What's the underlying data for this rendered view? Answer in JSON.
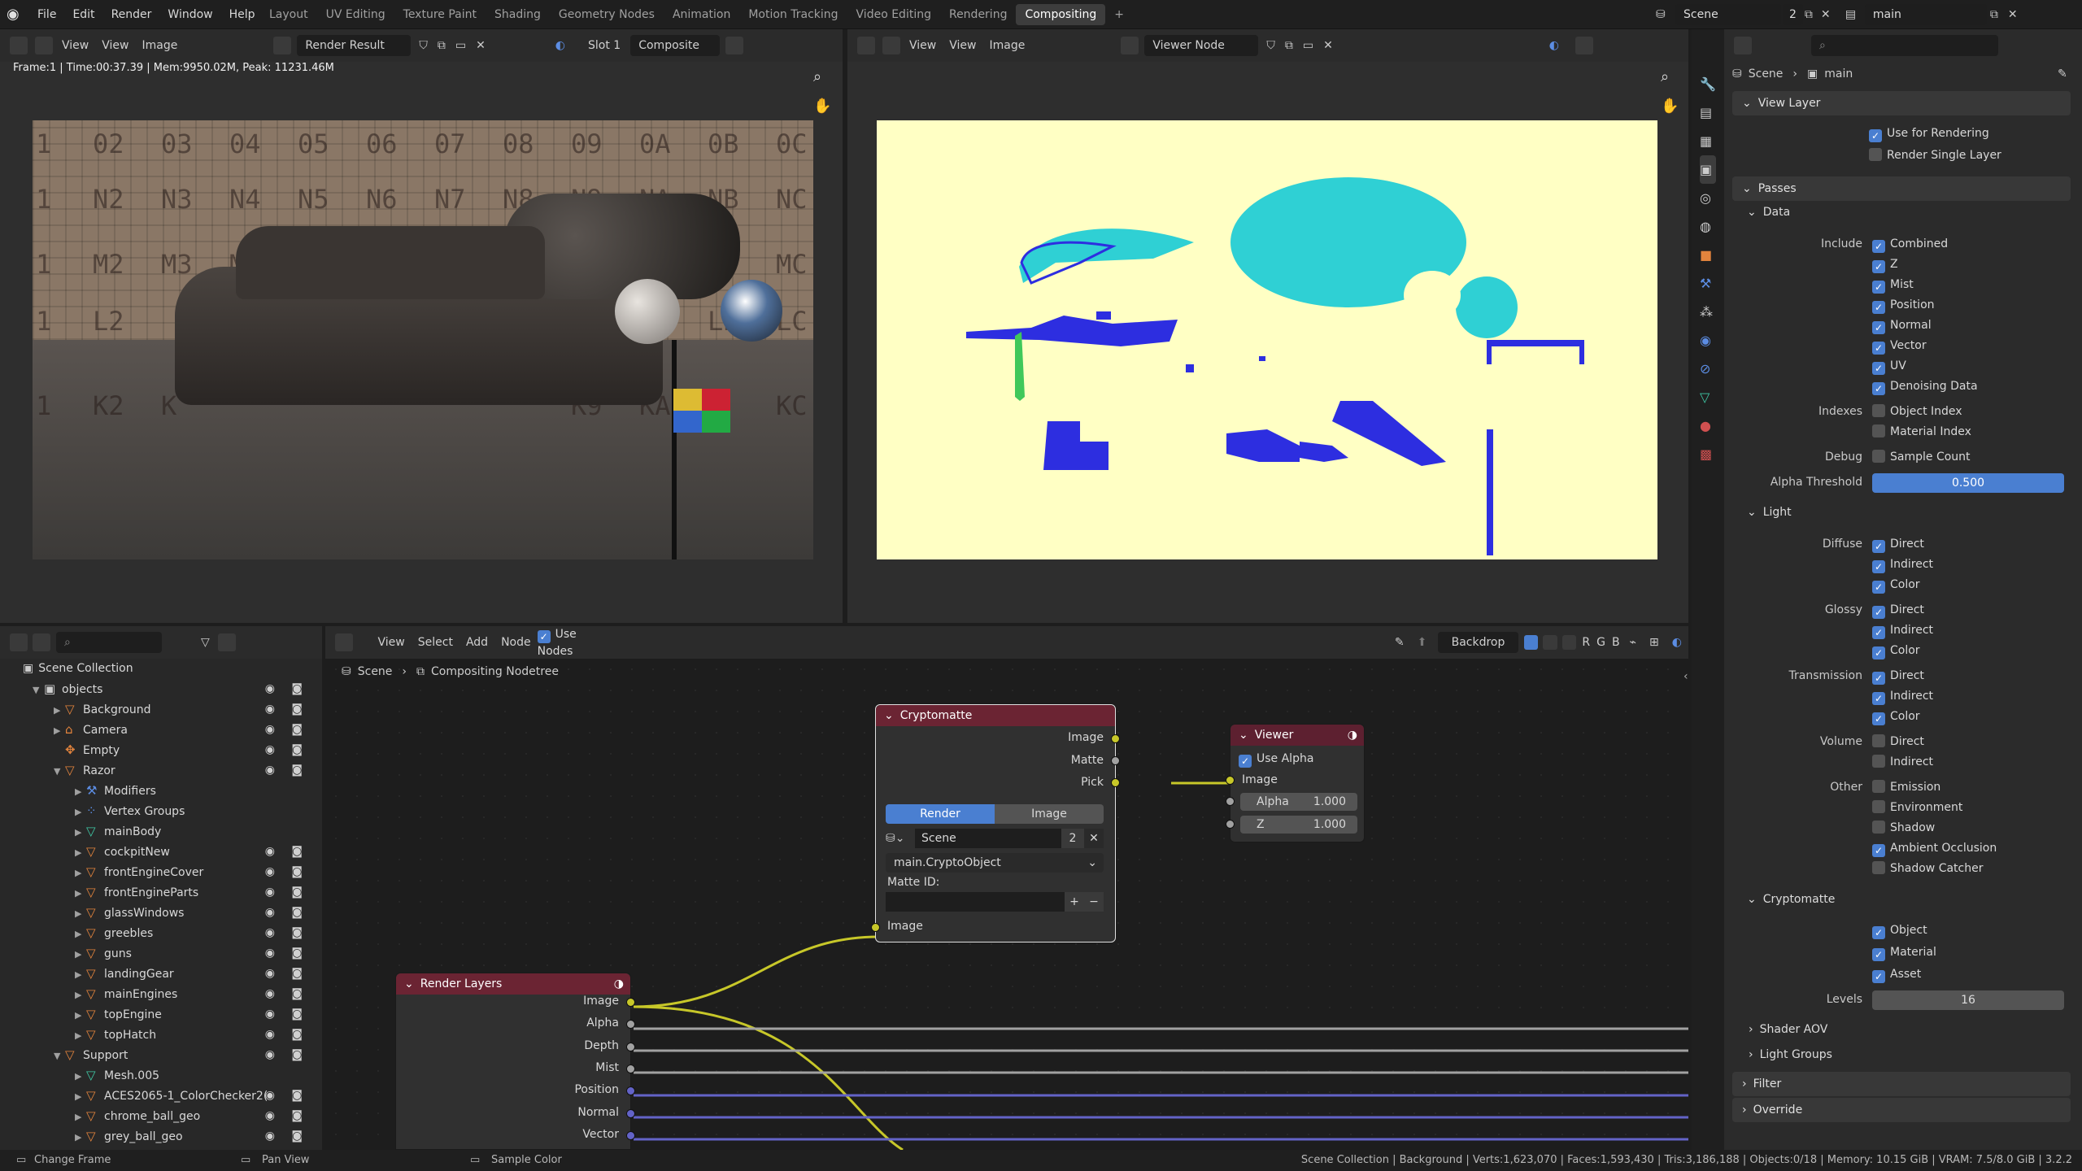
{
  "menu": {
    "file": "File",
    "edit": "Edit",
    "render": "Render",
    "window": "Window",
    "help": "Help"
  },
  "workspaces": [
    "Layout",
    "UV Editing",
    "Texture Paint",
    "Shading",
    "Geometry Nodes",
    "Animation",
    "Motion Tracking",
    "Video Editing",
    "Rendering",
    "Compositing"
  ],
  "scene": {
    "name": "Scene",
    "users": "2",
    "viewlayer": "main"
  },
  "left_viewer": {
    "view": "View",
    "image": "Image",
    "image_name": "Render Result",
    "slot": "Slot 1",
    "pass": "Composite",
    "stats": "Frame:1 | Time:00:37.39 | Mem:9950.02M, Peak: 11231.46M"
  },
  "right_viewer": {
    "view": "View",
    "view2": "View",
    "image": "Image",
    "image_name": "Viewer Node"
  },
  "left_render": {
    "grid_labels": [
      [
        "1",
        "02",
        "03",
        "04",
        "05",
        "06",
        "07",
        "08",
        "09",
        "0A",
        "0B",
        "0C"
      ],
      [
        "1",
        "N2",
        "N3",
        "N4",
        "N5",
        "N6",
        "N7",
        "N8",
        "N9",
        "NA",
        "NB",
        "NC"
      ],
      [
        "1",
        "M2",
        "M3",
        "M4",
        "",
        "",
        "",
        "",
        "",
        "",
        "",
        "MC"
      ],
      [
        "1",
        "L2",
        "",
        "",
        "",
        "",
        "",
        "",
        "",
        "",
        "LB",
        "LC"
      ],
      [
        "1",
        "K2",
        "K",
        "",
        "",
        "",
        "",
        "",
        "K9",
        "KA",
        "",
        "KC"
      ]
    ]
  },
  "outliner": {
    "root": "Scene Collection",
    "rows": [
      {
        "name": "objects",
        "depth": 1,
        "type": "collection"
      },
      {
        "name": "Background",
        "depth": 2,
        "type": "object"
      },
      {
        "name": "Camera",
        "depth": 2,
        "type": "camera"
      },
      {
        "name": "Empty",
        "depth": 2,
        "type": "empty"
      },
      {
        "name": "Razor",
        "depth": 2,
        "type": "object"
      },
      {
        "name": "Modifiers",
        "depth": 3,
        "type": "modifier"
      },
      {
        "name": "Vertex Groups",
        "depth": 3,
        "type": "vgroup"
      },
      {
        "name": "mainBody",
        "depth": 3,
        "type": "mesh"
      },
      {
        "name": "cockpitNew",
        "depth": 3,
        "type": "object"
      },
      {
        "name": "frontEngineCover",
        "depth": 3,
        "type": "object"
      },
      {
        "name": "frontEngineParts",
        "depth": 3,
        "type": "object"
      },
      {
        "name": "glassWindows",
        "depth": 3,
        "type": "object"
      },
      {
        "name": "greebles",
        "depth": 3,
        "type": "object"
      },
      {
        "name": "guns",
        "depth": 3,
        "type": "object"
      },
      {
        "name": "landingGear",
        "depth": 3,
        "type": "object"
      },
      {
        "name": "mainEngines",
        "depth": 3,
        "type": "object"
      },
      {
        "name": "topEngine",
        "depth": 3,
        "type": "object"
      },
      {
        "name": "topHatch",
        "depth": 3,
        "type": "object"
      },
      {
        "name": "Support",
        "depth": 2,
        "type": "object"
      },
      {
        "name": "Mesh.005",
        "depth": 3,
        "type": "mesh"
      },
      {
        "name": "ACES2065-1_ColorChecker2(",
        "depth": 3,
        "type": "object"
      },
      {
        "name": "chrome_ball_geo",
        "depth": 3,
        "type": "object"
      },
      {
        "name": "grey_ball_geo",
        "depth": 3,
        "type": "object"
      }
    ]
  },
  "node_editor": {
    "view": "View",
    "select": "Select",
    "add": "Add",
    "node": "Node",
    "use_nodes": "Use Nodes",
    "backdrop": "Backdrop",
    "r": "R",
    "g": "G",
    "b": "B",
    "breadcrumb_scene": "Scene",
    "breadcrumb_tree": "Compositing Nodetree"
  },
  "crypto_node": {
    "title": "Cryptomatte",
    "out_image": "Image",
    "out_matte": "Matte",
    "out_pick": "Pick",
    "tab_render": "Render",
    "tab_image": "Image",
    "scene": "Scene",
    "scene_users": "2",
    "layer": "main.CryptoObject",
    "matte_id": "Matte ID:",
    "in_image": "Image"
  },
  "viewer_node": {
    "title": "Viewer",
    "use_alpha": "Use Alpha",
    "in_image": "Image",
    "alpha_label": "Alpha",
    "alpha_val": "1.000",
    "z_label": "Z",
    "z_val": "1.000"
  },
  "render_layers_node": {
    "title": "Render Layers",
    "outputs": [
      "Image",
      "Alpha",
      "Depth",
      "Mist",
      "Position",
      "Normal",
      "Vector"
    ]
  },
  "properties": {
    "breadcrumb_scene": "Scene",
    "breadcrumb_layer": "main",
    "view_layer": "View Layer",
    "use_for_rendering": "Use for Rendering",
    "render_single_layer": "Render Single Layer",
    "passes": "Passes",
    "data": "Data",
    "include": "Include",
    "combined": "Combined",
    "z": "Z",
    "mist": "Mist",
    "position": "Position",
    "normal": "Normal",
    "vector": "Vector",
    "uv": "UV",
    "denoising": "Denoising Data",
    "indexes": "Indexes",
    "object_index": "Object Index",
    "material_index": "Material Index",
    "debug": "Debug",
    "sample_count": "Sample Count",
    "alpha_threshold": "Alpha Threshold",
    "alpha_threshold_val": "0.500",
    "light": "Light",
    "diffuse": "Diffuse",
    "glossy": "Glossy",
    "transmission": "Transmission",
    "volume": "Volume",
    "other": "Other",
    "direct": "Direct",
    "indirect": "Indirect",
    "color": "Color",
    "emission": "Emission",
    "environment": "Environment",
    "shadow": "Shadow",
    "ao": "Ambient Occlusion",
    "shadow_catcher": "Shadow Catcher",
    "cryptomatte": "Cryptomatte",
    "object": "Object",
    "material": "Material",
    "asset": "Asset",
    "levels": "Levels",
    "levels_val": "16",
    "shader_aov": "Shader AOV",
    "light_groups": "Light Groups",
    "filter": "Filter",
    "override": "Override"
  },
  "status": {
    "change_frame": "Change Frame",
    "pan_view": "Pan View",
    "sample_color": "Sample Color",
    "stats": "Scene Collection | Background | Verts:1,623,070 | Faces:1,593,430 | Tris:3,186,188 | Objects:0/18 | Memory: 10.15 GiB | VRAM: 7.5/8.0 GiB | 3.2.2"
  },
  "colors": {
    "accent": "#4a7fd1",
    "crypto_header": "#7a2a3a",
    "render_layers_header": "#7a2a3a",
    "viewer_header": "#6e2a35",
    "matte_bg": "#ffffc4",
    "matte_cyan": "#2fd0d4",
    "matte_blue": "#2d2ee0"
  }
}
